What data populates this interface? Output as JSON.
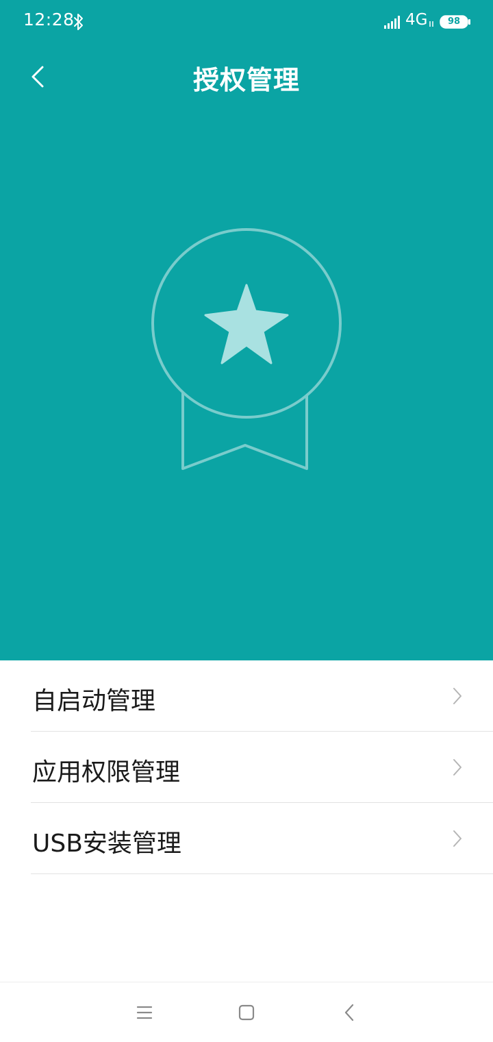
{
  "status_bar": {
    "time": "12:28",
    "network": "4G",
    "battery": "98"
  },
  "header": {
    "title": "授权管理"
  },
  "menu": {
    "items": [
      {
        "label": "自启动管理"
      },
      {
        "label": "应用权限管理"
      },
      {
        "label": "USB安装管理"
      }
    ]
  },
  "icons": {
    "bluetooth": "bluetooth-icon",
    "signal": "signal-icon",
    "battery": "battery-icon",
    "back": "back-arrow-icon",
    "badge": "award-badge-icon",
    "chevron": "chevron-right-icon",
    "nav_menu": "menu-icon",
    "nav_home": "home-icon",
    "nav_back": "back-icon"
  },
  "colors": {
    "accent": "#0ba4a4",
    "badge_fill": "#a9e1e1",
    "text": "#1a1a1a",
    "divider": "#e2e2e2",
    "chevron": "#b5b5b5"
  }
}
